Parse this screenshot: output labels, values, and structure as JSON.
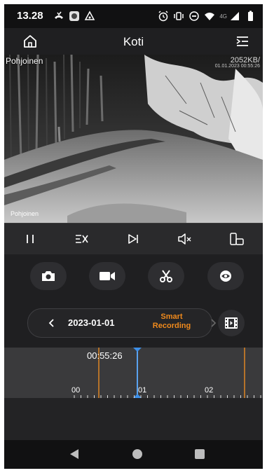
{
  "status_bar": {
    "time": "13.28",
    "network_label": "4G",
    "icons": [
      "missed-call-icon",
      "camera-app-icon",
      "drive-icon",
      "alarm-icon",
      "vibrate-icon",
      "do-not-disturb-icon",
      "wifi-icon",
      "signal-icon",
      "battery-icon"
    ]
  },
  "header": {
    "title": "Koti",
    "left_icon": "home-icon",
    "right_icon": "menu-icon"
  },
  "video": {
    "camera_name": "Pohjoinen",
    "bitrate": "2052KB/",
    "timestamp": "01.01.2023 00:55:26",
    "overlay_name": "Pohjoinen"
  },
  "controls": [
    {
      "name": "pause-icon"
    },
    {
      "name": "stream-quality-icon"
    },
    {
      "name": "play-next-icon"
    },
    {
      "name": "mute-icon"
    },
    {
      "name": "rotate-screen-icon"
    }
  ],
  "actions": [
    {
      "name": "snapshot-icon"
    },
    {
      "name": "record-video-icon"
    },
    {
      "name": "cut-clip-icon"
    },
    {
      "name": "playback-view-icon"
    }
  ],
  "date_bar": {
    "date": "2023-01-01",
    "recording_type_line1": "Smart",
    "recording_type_line2": "Recording",
    "accent": "#f08a1c"
  },
  "timeline": {
    "current_time": "00:55:26",
    "hour_labels": [
      "00",
      "01",
      "02"
    ],
    "cursor_color": "#3d8fe8",
    "recording_marker_color": "#b5732a"
  }
}
